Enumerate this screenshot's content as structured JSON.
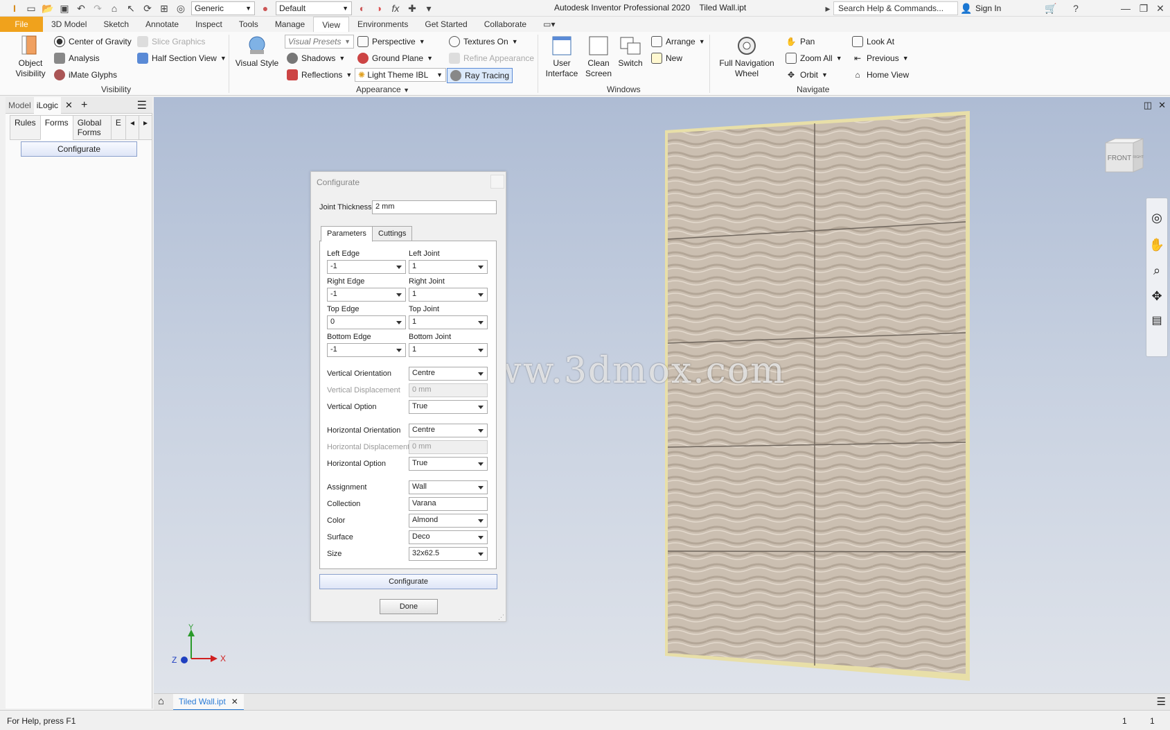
{
  "titlebar": {
    "style_combo": "Generic",
    "appearance_combo": "Default",
    "app_title": "Autodesk Inventor Professional 2020",
    "doc_title": "Tiled Wall.ipt",
    "search_placeholder": "Search Help & Commands...",
    "sign_in": "Sign In"
  },
  "menu": {
    "tabs": [
      "File",
      "3D Model",
      "Sketch",
      "Annotate",
      "Inspect",
      "Tools",
      "Manage",
      "View",
      "Environments",
      "Get Started",
      "Collaborate"
    ],
    "active": "View"
  },
  "ribbon": {
    "visibility": {
      "object_visibility_1": "Object",
      "object_visibility_2": "Visibility",
      "center_of_gravity": "Center of Gravity",
      "analysis": "Analysis",
      "imate_glyphs": "iMate Glyphs",
      "slice_graphics": "Slice Graphics",
      "half_section_view": "Half Section View",
      "label": "Visibility"
    },
    "appearance": {
      "visual_style": "Visual Style",
      "visual_presets": "Visual Presets",
      "perspective": "Perspective",
      "textures_on": "Textures On",
      "shadows": "Shadows",
      "ground_plane": "Ground Plane",
      "refine_appearance": "Refine Appearance",
      "reflections": "Reflections",
      "light_theme": "Light Theme IBL",
      "ray_tracing": "Ray Tracing",
      "label": "Appearance"
    },
    "windows": {
      "user_interface_1": "User",
      "user_interface_2": "Interface",
      "clean_screen_1": "Clean",
      "clean_screen_2": "Screen",
      "switch": "Switch",
      "arrange": "Arrange",
      "new": "New",
      "label": "Windows"
    },
    "navigate": {
      "full_nav_1": "Full Navigation",
      "full_nav_2": "Wheel",
      "pan": "Pan",
      "zoom_all": "Zoom All",
      "orbit": "Orbit",
      "look_at": "Look At",
      "previous": "Previous",
      "home_view": "Home View",
      "label": "Navigate"
    }
  },
  "browser": {
    "tab_model": "Model",
    "tab_ilogic": "iLogic",
    "subtabs": [
      "Rules",
      "Forms",
      "Global Forms",
      "E"
    ],
    "active_subtab": "Forms",
    "configure_button": "Configurate"
  },
  "dialog": {
    "title": "Configurate",
    "joint_thickness_label": "Joint Thickness",
    "joint_thickness_value": "2 mm",
    "tabs": [
      "Parameters",
      "Cuttings"
    ],
    "left_edge_label": "Left Edge",
    "left_edge": "-1",
    "left_joint_label": "Left Joint",
    "left_joint": "1",
    "right_edge_label": "Right Edge",
    "right_edge": "-1",
    "right_joint_label": "Right Joint",
    "right_joint": "1",
    "top_edge_label": "Top Edge",
    "top_edge": "0",
    "top_joint_label": "Top Joint",
    "top_joint": "1",
    "bottom_edge_label": "Bottom Edge",
    "bottom_edge": "-1",
    "bottom_joint_label": "Bottom Joint",
    "bottom_joint": "1",
    "vertical_orientation_label": "Vertical Orientation",
    "vertical_orientation": "Centre",
    "vertical_displacement_label": "Vertical Displacement",
    "vertical_displacement": "0 mm",
    "vertical_option_label": "Vertical Option",
    "vertical_option": "True",
    "horizontal_orientation_label": "Horizontal Orientation",
    "horizontal_orientation": "Centre",
    "horizontal_displacement_label": "Horizontal Displacement",
    "horizontal_displacement": "0 mm",
    "horizontal_option_label": "Horizontal Option",
    "horizontal_option": "True",
    "assignment_label": "Assignment",
    "assignment": "Wall",
    "collection_label": "Collection",
    "collection": "Varana",
    "color_label": "Color",
    "color": "Almond",
    "surface_label": "Surface",
    "surface": "Deco",
    "size_label": "Size",
    "size": "32x62.5",
    "configure_button": "Configurate",
    "done_button": "Done"
  },
  "viewport": {
    "viewcube_front": "FRONT",
    "viewcube_right": "RIGHT",
    "watermark": "资西网www.3dmox.com",
    "axis_x": "X",
    "axis_y": "Y",
    "axis_z": "Z"
  },
  "doctab": {
    "label": "Tiled Wall.ipt"
  },
  "status": {
    "help": "For Help, press F1",
    "count1": "1",
    "count2": "1"
  },
  "colors": {
    "accent": "#2a7bd6",
    "file_tab": "#f0a21c",
    "wall": "#c9bcae"
  }
}
